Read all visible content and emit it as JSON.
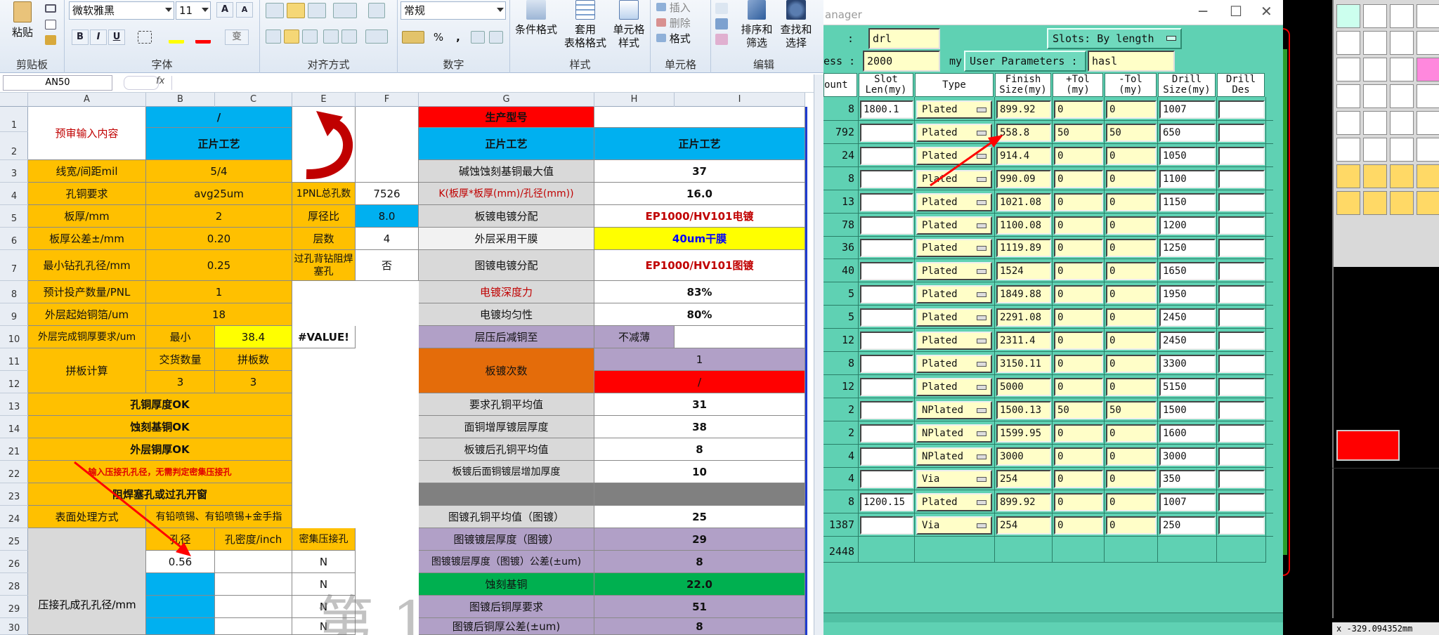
{
  "excel": {
    "ribbon": {
      "clipboard": {
        "paste": "粘贴",
        "label": "剪贴板"
      },
      "font": {
        "name": "微软雅黑",
        "size": "11",
        "bold": "B",
        "italic": "I",
        "underline": "U",
        "grow": "A",
        "shrink": "A",
        "phonetic": "变",
        "label": "字体"
      },
      "alignment": {
        "label": "对齐方式"
      },
      "number": {
        "format": "常规",
        "label": "数字",
        "percent": "%",
        "comma": ","
      },
      "styles": {
        "conditional": "条件格式",
        "table_format_1": "套用",
        "table_format_2": "表格格式",
        "cell_styles_1": "单元格",
        "cell_styles_2": "样式",
        "label": "样式"
      },
      "cells": {
        "insert": "插入",
        "delete": "删除",
        "format": "格式",
        "label": "单元格"
      },
      "editing": {
        "sort_1": "排序和",
        "sort_2": "筛选",
        "find_1": "查找和",
        "find_2": "选择",
        "label": "编辑"
      }
    },
    "name_box": "AN50",
    "fx": "fx",
    "columns": [
      "A",
      "B",
      "C",
      "E",
      "F",
      "G",
      "H",
      "I"
    ],
    "rows": [
      "1",
      "2",
      "3",
      "4",
      "5",
      "6",
      "7",
      "8",
      "9",
      "10",
      "11",
      "12",
      "13",
      "14",
      "21",
      "22",
      "23",
      "24",
      "25",
      "26",
      "28",
      "29",
      "30"
    ],
    "cells": {
      "a1": "预审输入内容",
      "b1": "/",
      "b2": "正片工艺",
      "g1": "生产型号",
      "g2": "正片工艺",
      "i2": "正片工艺",
      "a3": "线宽/间距mil",
      "b3": "5/4",
      "g3": "碱蚀蚀刻基铜最大值",
      "i3": "37",
      "a4": "孔铜要求",
      "b4": "avg25um",
      "e4": "1PNL总孔数",
      "f4": "7526",
      "g4": "K(板厚*板厚(mm)/孔径(mm))",
      "i4": "16.0",
      "a5": "板厚/mm",
      "b5": "2",
      "e5": "厚径比",
      "f5": "8.0",
      "g5": "板镀电镀分配",
      "i5": "EP1000/HV101电镀",
      "a6": "板厚公差±/mm",
      "b6": "0.20",
      "e6": "层数",
      "f6": "4",
      "g6": "外层采用干膜",
      "i6": "40um干膜",
      "a7": "最小钻孔孔径/mm",
      "b7": "0.25",
      "e7": "过孔背钻阻焊塞孔",
      "f7": "否",
      "g7": "图镀电镀分配",
      "i7": "EP1000/HV101图镀",
      "a8": "预计投产数量/PNL",
      "b8": "1",
      "g8": "电镀深度力",
      "i8": "83%",
      "a9": "外层起始铜箔/um",
      "b9": "18",
      "g9": "电镀均匀性",
      "i9": "80%",
      "a10": "外层完成铜厚要求/um",
      "b10": "最小",
      "c10": "38.4",
      "e10": "#VALUE!",
      "g10": "层压后减铜至",
      "h10": "不减薄",
      "a11": "拼板计算",
      "b11": "交货数量",
      "c11": "拼板数",
      "b12": "3",
      "c12": "3",
      "g11": "板镀次数",
      "h11": "1",
      "h12": "/",
      "a13": "孔铜厚度OK",
      "g13": "要求孔铜平均值",
      "i13": "31",
      "a14": "蚀刻基铜OK",
      "g14": "面铜增厚镀层厚度",
      "i14": "38",
      "a21": "外层铜厚OK",
      "g21": "板镀后孔铜平均值",
      "i21": "8",
      "a22": "输入压接孔孔径，无需判定密集压接孔",
      "g22": "板镀后面铜镀层增加厚度",
      "i22": "10",
      "a23": "阻焊塞孔或过孔开窗",
      "a24": "表面处理方式",
      "b24": "有铅喷锡、有铅喷锡+金手指",
      "g24": "图镀孔铜平均值（图镀）",
      "i24": "25",
      "b25": "孔径",
      "c25": "孔密度/inch",
      "e25": "密集压接孔",
      "g25": "图镀镀层厚度（图镀）",
      "i25": "29",
      "b26": "0.56",
      "e26": "N",
      "g26": "图镀镀层厚度（图镀）公差(±um)",
      "i26": "8",
      "a28": "压接孔成孔孔径/mm",
      "e28": "N",
      "g28": "蚀刻基铜",
      "i28": "22.0",
      "e29": "N",
      "g29": "图镀后铜厚要求",
      "i29": "51",
      "e30": "N",
      "g30": "图镀后铜厚公差(±um)",
      "i30": "8"
    },
    "watermark": "第 1"
  },
  "drill": {
    "title": "anager",
    "tool_name": "drl",
    "slots_label": "Slots:",
    "slots_value": "By length",
    "thickness_label": "ess :",
    "thickness_value": "2000",
    "thickness_unit": "my",
    "user_params_label": "User Parameters :",
    "user_params_value": "hasl",
    "headers": [
      "ount",
      "Slot\nLen(my)",
      "Type",
      "Finish\nSize(my)",
      "+Tol\n(my)",
      "-Tol\n(my)",
      "Drill\nSize(my)",
      "Drill\nDes"
    ],
    "rows": [
      {
        "count": "8",
        "slot": "1800.1",
        "type": "Plated",
        "finish": "899.92",
        "ptol": "0",
        "ntol": "0",
        "drill": "1007",
        "des": ""
      },
      {
        "count": "792",
        "slot": "",
        "type": "Plated",
        "finish": "558.8",
        "ptol": "50",
        "ntol": "50",
        "drill": "650",
        "des": ""
      },
      {
        "count": "24",
        "slot": "",
        "type": "Plated",
        "finish": "914.4",
        "ptol": "0",
        "ntol": "0",
        "drill": "1050",
        "des": ""
      },
      {
        "count": "8",
        "slot": "",
        "type": "Plated",
        "finish": "990.09",
        "ptol": "0",
        "ntol": "0",
        "drill": "1100",
        "des": ""
      },
      {
        "count": "13",
        "slot": "",
        "type": "Plated",
        "finish": "1021.08",
        "ptol": "0",
        "ntol": "0",
        "drill": "1150",
        "des": ""
      },
      {
        "count": "78",
        "slot": "",
        "type": "Plated",
        "finish": "1100.08",
        "ptol": "0",
        "ntol": "0",
        "drill": "1200",
        "des": ""
      },
      {
        "count": "36",
        "slot": "",
        "type": "Plated",
        "finish": "1119.89",
        "ptol": "0",
        "ntol": "0",
        "drill": "1250",
        "des": ""
      },
      {
        "count": "40",
        "slot": "",
        "type": "Plated",
        "finish": "1524",
        "ptol": "0",
        "ntol": "0",
        "drill": "1650",
        "des": ""
      },
      {
        "count": "5",
        "slot": "",
        "type": "Plated",
        "finish": "1849.88",
        "ptol": "0",
        "ntol": "0",
        "drill": "1950",
        "des": ""
      },
      {
        "count": "5",
        "slot": "",
        "type": "Plated",
        "finish": "2291.08",
        "ptol": "0",
        "ntol": "0",
        "drill": "2450",
        "des": ""
      },
      {
        "count": "12",
        "slot": "",
        "type": "Plated",
        "finish": "2311.4",
        "ptol": "0",
        "ntol": "0",
        "drill": "2450",
        "des": ""
      },
      {
        "count": "8",
        "slot": "",
        "type": "Plated",
        "finish": "3150.11",
        "ptol": "0",
        "ntol": "0",
        "drill": "3300",
        "des": ""
      },
      {
        "count": "12",
        "slot": "",
        "type": "Plated",
        "finish": "5000",
        "ptol": "0",
        "ntol": "0",
        "drill": "5150",
        "des": ""
      },
      {
        "count": "2",
        "slot": "",
        "type": "NPlated",
        "finish": "1500.13",
        "ptol": "50",
        "ntol": "50",
        "drill": "1500",
        "des": ""
      },
      {
        "count": "2",
        "slot": "",
        "type": "NPlated",
        "finish": "1599.95",
        "ptol": "0",
        "ntol": "0",
        "drill": "1600",
        "des": ""
      },
      {
        "count": "4",
        "slot": "",
        "type": "NPlated",
        "finish": "3000",
        "ptol": "0",
        "ntol": "0",
        "drill": "3000",
        "des": ""
      },
      {
        "count": "4",
        "slot": "",
        "type": "Via",
        "finish": "254",
        "ptol": "0",
        "ntol": "0",
        "drill": "350",
        "des": ""
      },
      {
        "count": "8",
        "slot": "1200.15",
        "type": "Plated",
        "finish": "899.92",
        "ptol": "0",
        "ntol": "0",
        "drill": "1007",
        "des": ""
      },
      {
        "count": "1387",
        "slot": "",
        "type": "Via",
        "finish": "254",
        "ptol": "0",
        "ntol": "0",
        "drill": "250",
        "des": ""
      }
    ],
    "total": "2448"
  },
  "cad": {
    "status": "x  -329.094352mm"
  }
}
